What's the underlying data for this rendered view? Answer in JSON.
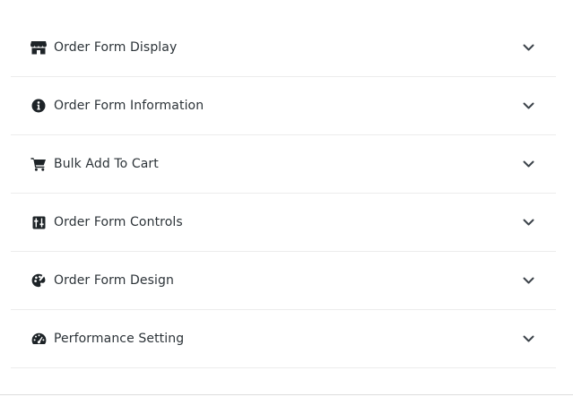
{
  "settings": {
    "sections": [
      {
        "label": "Order Form Display",
        "icon": "store-icon"
      },
      {
        "label": "Order Form Information",
        "icon": "info-icon"
      },
      {
        "label": "Bulk Add To Cart",
        "icon": "cart-icon"
      },
      {
        "label": "Order Form Controls",
        "icon": "sliders-icon"
      },
      {
        "label": "Order Form Design",
        "icon": "palette-icon"
      },
      {
        "label": "Performance Setting",
        "icon": "gauge-icon"
      }
    ]
  }
}
